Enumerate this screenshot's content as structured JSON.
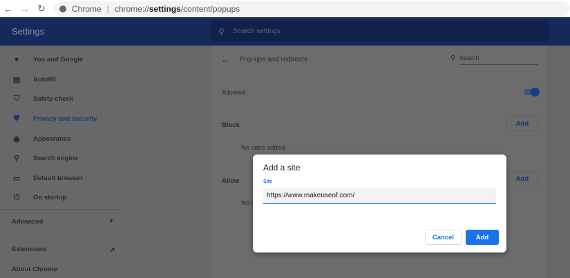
{
  "browser": {
    "brand": "Chrome",
    "url_prefix": "chrome://",
    "url_bold": "settings",
    "url_suffix": "/content/popups"
  },
  "header": {
    "title": "Settings",
    "search_placeholder": "Search settings"
  },
  "sidebar": {
    "items": [
      {
        "label": "You and Google",
        "icon": "person-icon"
      },
      {
        "label": "Autofill",
        "icon": "clipboard-icon"
      },
      {
        "label": "Safety check",
        "icon": "shield-check-icon"
      },
      {
        "label": "Privacy and security",
        "icon": "shield-icon",
        "active": true
      },
      {
        "label": "Appearance",
        "icon": "palette-icon"
      },
      {
        "label": "Search engine",
        "icon": "search-icon"
      },
      {
        "label": "Default browser",
        "icon": "browser-icon"
      },
      {
        "label": "On startup",
        "icon": "power-icon"
      }
    ],
    "advanced": "Advanced",
    "extensions": "Extensions",
    "about": "About Chrome"
  },
  "main": {
    "title": "Pop-ups and redirects",
    "search_placeholder": "Search",
    "allowed_label": "Allowed",
    "allowed_on": true,
    "block_label": "Block",
    "block_add": "Add",
    "block_empty": "No sites added",
    "allow_label": "Allow",
    "allow_add": "Add",
    "allow_empty": "No sites added"
  },
  "dialog": {
    "title": "Add a site",
    "field_label": "Site",
    "field_value": "https://www.makeuseof.com/",
    "cancel": "Cancel",
    "add": "Add"
  },
  "colors": {
    "accent": "#1a73e8",
    "header": "#15295a"
  }
}
